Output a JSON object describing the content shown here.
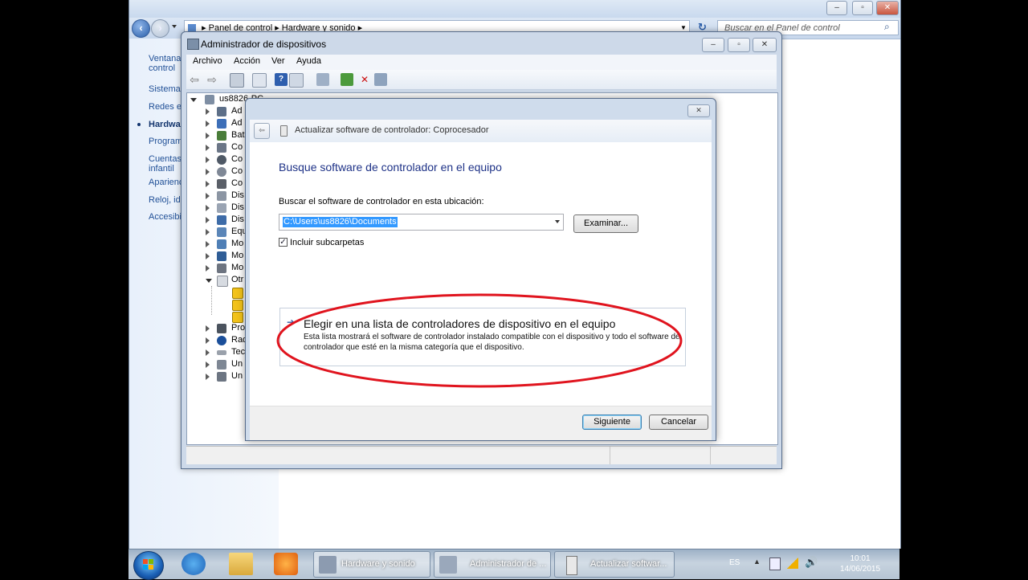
{
  "control_panel": {
    "breadcrumb": [
      "Panel de control",
      "Hardware y sonido"
    ],
    "search_placeholder": "Buscar en el Panel de control",
    "left_links": [
      "Ventana",
      "control",
      "Sistema",
      "Redes e",
      "Hardwar",
      "Program",
      "Cuentas",
      "infantil",
      "Aparienc",
      "Reloj, id",
      "Accesibil"
    ]
  },
  "device_manager": {
    "title": "Administrador de dispositivos",
    "menu": [
      "Archivo",
      "Acción",
      "Ver",
      "Ayuda"
    ],
    "root": "us8826-PC",
    "tree": [
      "Ad",
      "Ad",
      "Bat",
      "Co",
      "Co",
      "Co",
      "Co",
      "Dis",
      "Dis",
      "Dis",
      "Equ",
      "Mo",
      "Mo",
      "Mo",
      "Otr",
      "",
      "",
      "",
      "Pro",
      "Rad",
      "Tec",
      "Un",
      "Un"
    ]
  },
  "dialog": {
    "header": "Actualizar software de controlador: Coprocesador",
    "heading": "Busque software de controlador en el equipo",
    "label": "Buscar el software de controlador en esta ubicación:",
    "path": "C:\\Users\\us8826\\Documents",
    "browse": "Examinar...",
    "checkbox_label": "Incluir subcarpetas",
    "checkbox_checked": true,
    "option_title": "Elegir en una lista de controladores de dispositivo en el equipo",
    "option_desc": "Esta lista mostrará el software de controlador instalado compatible con el dispositivo y todo el software de controlador que esté en la misma categoría que el dispositivo.",
    "next": "Siguiente",
    "cancel": "Cancelar",
    "annotation_color": "#e0141e"
  },
  "taskbar": {
    "tasks": [
      "Hardware y sonido",
      "Administrador de ...",
      "Actualizar softwar..."
    ],
    "language": "ES",
    "time": "10:01",
    "date": "14/06/2015"
  }
}
